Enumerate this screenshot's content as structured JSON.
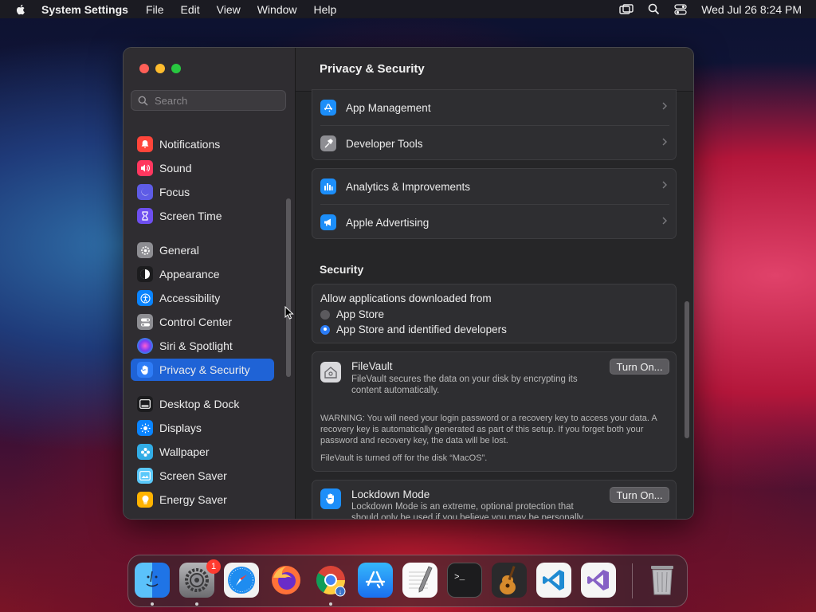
{
  "menubar": {
    "app_name": "System Settings",
    "menus": [
      "File",
      "Edit",
      "View",
      "Window",
      "Help"
    ],
    "clock": "Wed Jul 26  8:24 PM"
  },
  "sidebar": {
    "search_placeholder": "Search",
    "items": [
      {
        "label": "Notifications",
        "color": "#ff453a"
      },
      {
        "label": "Sound",
        "color": "#ff375f"
      },
      {
        "label": "Focus",
        "color": "#5e5ce6"
      },
      {
        "label": "Screen Time",
        "color": "#6e4ff0"
      },
      {
        "label": "General",
        "color": "#8e8e93"
      },
      {
        "label": "Appearance",
        "color": "#1c1c1e"
      },
      {
        "label": "Accessibility",
        "color": "#0a84ff"
      },
      {
        "label": "Control Center",
        "color": "#8e8e93"
      },
      {
        "label": "Siri & Spotlight",
        "color": "#bf5af2"
      },
      {
        "label": "Privacy & Security",
        "color": "#2e7cf6"
      },
      {
        "label": "Desktop & Dock",
        "color": "#1c1c1e"
      },
      {
        "label": "Displays",
        "color": "#0a84ff"
      },
      {
        "label": "Wallpaper",
        "color": "#32ade6"
      },
      {
        "label": "Screen Saver",
        "color": "#5ac8fa"
      },
      {
        "label": "Energy Saver",
        "color": "#ffb300"
      }
    ],
    "selected": "Privacy & Security"
  },
  "main": {
    "title": "Privacy & Security",
    "rows_group1": [
      {
        "label": "App Management"
      },
      {
        "label": "Developer Tools"
      }
    ],
    "rows_group2": [
      {
        "label": "Analytics & Improvements"
      },
      {
        "label": "Apple Advertising"
      }
    ],
    "security": {
      "section_title": "Security",
      "allow_label": "Allow applications downloaded from",
      "option1": "App Store",
      "option2": "App Store and identified developers",
      "selected_option": "App Store and identified developers"
    },
    "filevault": {
      "title": "FileVault",
      "desc": "FileVault secures the data on your disk by encrypting its content automatically.",
      "button": "Turn On...",
      "warning": "WARNING: You will need your login password or a recovery key to access your data. A recovery key is automatically generated as part of this setup. If you forget both your password and recovery key, the data will be lost.",
      "status": "FileVault is turned off for the disk “MacOS”."
    },
    "lockdown": {
      "title": "Lockdown Mode",
      "desc": "Lockdown Mode is an extreme, optional protection that should only be used if you believe you may be personally",
      "button": "Turn On..."
    }
  },
  "dock": {
    "apps": [
      "Finder",
      "System Settings",
      "Safari",
      "Firefox",
      "Chrome",
      "App Store",
      "TextEdit",
      "Terminal",
      "GarageBand",
      "Visual Studio Code",
      "Visual Studio",
      "Trash"
    ],
    "settings_badge": "1"
  }
}
